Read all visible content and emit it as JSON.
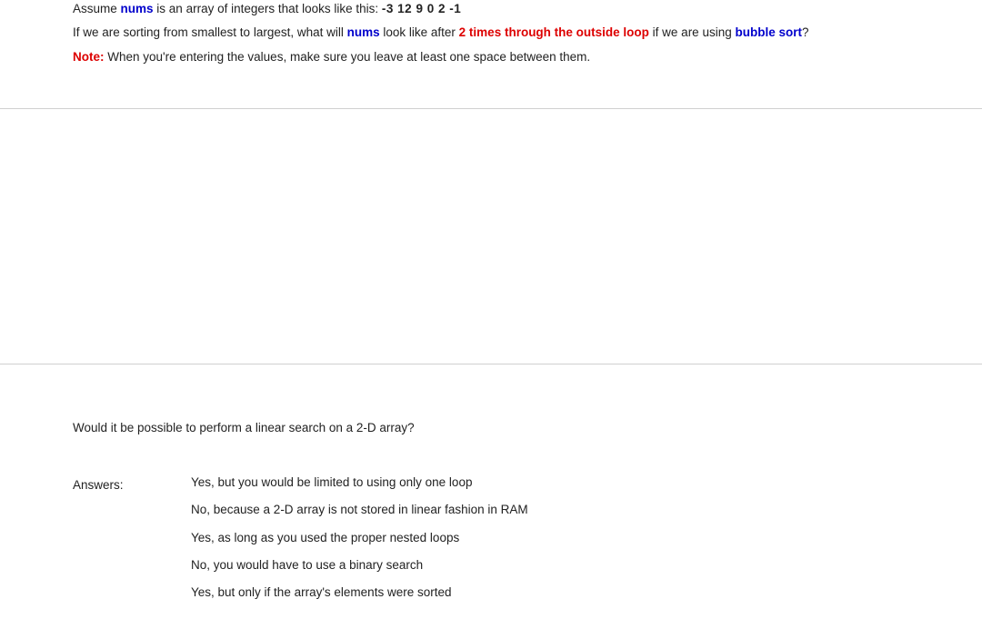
{
  "q1": {
    "line1_pre": "Assume ",
    "line1_kw1": "nums",
    "line1_mid": " is an array of integers that looks like this:   ",
    "line1_arr": "-3   12   9   0   2   -1",
    "line2_pre": "If we are sorting from smallest to largest, what will ",
    "line2_kw1": "nums",
    "line2_mid": " look like after ",
    "line2_red": "2 times through the outside loop",
    "line2_mid2": " if we are using ",
    "line2_kw2": "bubble sort",
    "line2_end": "?",
    "note_label": "Note:",
    "note_body": " When you're entering the values, make sure you leave at least one space between them."
  },
  "q2": {
    "question": "Would it be possible to perform a linear search on a 2-D array?",
    "answers_label": "Answers:",
    "answers": [
      "Yes, but you would be limited to using only one loop",
      "No, because a 2-D array is not stored in linear fashion in RAM",
      "Yes, as long as you used the proper nested loops",
      "No, you would have to use a binary search",
      "Yes, but only if the array's elements were sorted"
    ]
  }
}
